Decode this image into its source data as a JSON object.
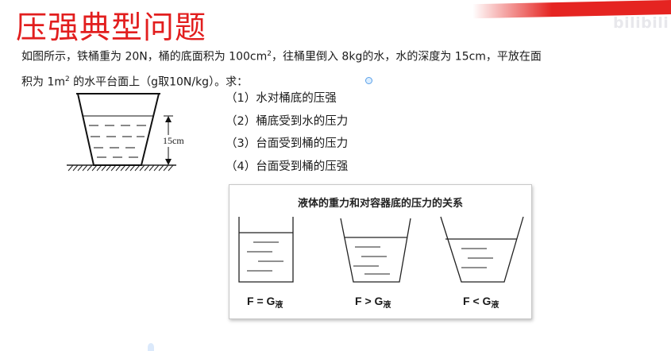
{
  "title": "压强典型问题",
  "watermark": "bilibili",
  "problem": {
    "line1_before": "如图所示，铁桶重为 20N，桶的底面积为 100cm",
    "line1_sup": "2",
    "line1_after": "，往桶里倒入 8kg的水，水的深度为 15cm，平放在面",
    "line2_before": "积为 1m",
    "line2_sup": "2",
    "line2_after": " 的水平台面上（g取10N/kg）。求："
  },
  "figure": {
    "depth_label": "15cm"
  },
  "questions": [
    "（1）水对桶底的压强",
    "（2）桶底受到水的压力",
    "（3）台面受到桶的压力",
    "（4）台面受到桶的压强"
  ],
  "relation": {
    "title": "液体的重力和对容器底的压力的关系",
    "formulas": [
      {
        "main": "F = G",
        "sub": "液"
      },
      {
        "main": "F > G",
        "sub": "液"
      },
      {
        "main": "F < G",
        "sub": "液"
      }
    ]
  },
  "colors": {
    "title": "#e21e1e",
    "accent_stripe": "#e52421"
  }
}
